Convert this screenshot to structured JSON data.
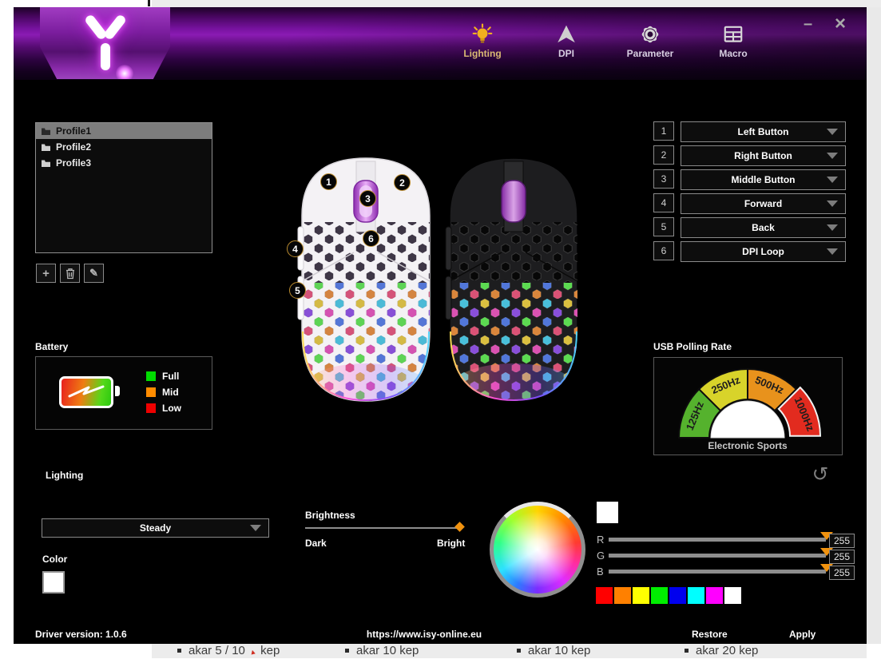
{
  "titlebar": {
    "minimize_label": "–",
    "close_label": "×",
    "nav": [
      {
        "label": "Lighting",
        "icon": "lightbulb-icon",
        "active": true
      },
      {
        "label": "DPI",
        "icon": "cursor-arrow-icon",
        "active": false
      },
      {
        "label": "Parameter",
        "icon": "gear-icon",
        "active": false
      },
      {
        "label": "Macro",
        "icon": "grid-table-icon",
        "active": false
      }
    ]
  },
  "profiles": {
    "items": [
      {
        "label": "Profile1",
        "selected": true
      },
      {
        "label": "Profile2",
        "selected": false
      },
      {
        "label": "Profile3",
        "selected": false
      }
    ],
    "actions": [
      {
        "name": "add-profile",
        "glyph": "+"
      },
      {
        "name": "delete-profile",
        "glyph": "trash-icon"
      },
      {
        "name": "edit-profile",
        "glyph": "pencil-icon"
      }
    ]
  },
  "button_mapping": {
    "rows": [
      {
        "num": "1",
        "value": "Left Button"
      },
      {
        "num": "2",
        "value": "Right Button"
      },
      {
        "num": "3",
        "value": "Middle Button"
      },
      {
        "num": "4",
        "value": "Forward"
      },
      {
        "num": "5",
        "value": "Back"
      },
      {
        "num": "6",
        "value": "DPI Loop"
      }
    ]
  },
  "battery": {
    "label": "Battery",
    "legend": [
      {
        "label": "Full",
        "color": "#00dc00"
      },
      {
        "label": "Mid",
        "color": "#ff8c00"
      },
      {
        "label": "Low",
        "color": "#ee0000"
      }
    ]
  },
  "polling_rate": {
    "label": "USB Polling Rate",
    "caption": "Electronic Sports",
    "segments": [
      {
        "label": "125Hz",
        "color": "#55b22d"
      },
      {
        "label": "250Hz",
        "color": "#d8d32a"
      },
      {
        "label": "500Hz",
        "color": "#e8921c"
      },
      {
        "label": "1000Hz",
        "color": "#e22b1f"
      }
    ]
  },
  "lighting_panel": {
    "section_label": "Lighting",
    "mode_value": "Steady",
    "color_label": "Color",
    "color_value": "#ffffff",
    "preview_color": "#ffffff",
    "brightness": {
      "label": "Brightness",
      "min_label": "Dark",
      "max_label": "Bright"
    },
    "rgb": [
      {
        "label": "R",
        "value": "255"
      },
      {
        "label": "G",
        "value": "255"
      },
      {
        "label": "B",
        "value": "255"
      }
    ],
    "swatches": [
      "#ff0000",
      "#ff8000",
      "#ffff00",
      "#00ee00",
      "#0000ee",
      "#00ffff",
      "#ff00ff",
      "#ffffff"
    ]
  },
  "mouse_area": {
    "callouts": [
      "1",
      "2",
      "3",
      "4",
      "5",
      "6"
    ]
  },
  "footer": {
    "driver_version": "Driver version: 1.0.6",
    "url": "https://www.isy-online.eu",
    "restore_label": "Restore",
    "apply_label": "Apply"
  },
  "page_background": {
    "items": [
      {
        "prefix": "akar 5 / 10",
        "suffix": "kep",
        "flag": true
      },
      {
        "text": "akar 10 kep"
      },
      {
        "text": "akar 10 kep"
      },
      {
        "text": "akar 20 kep"
      }
    ]
  }
}
